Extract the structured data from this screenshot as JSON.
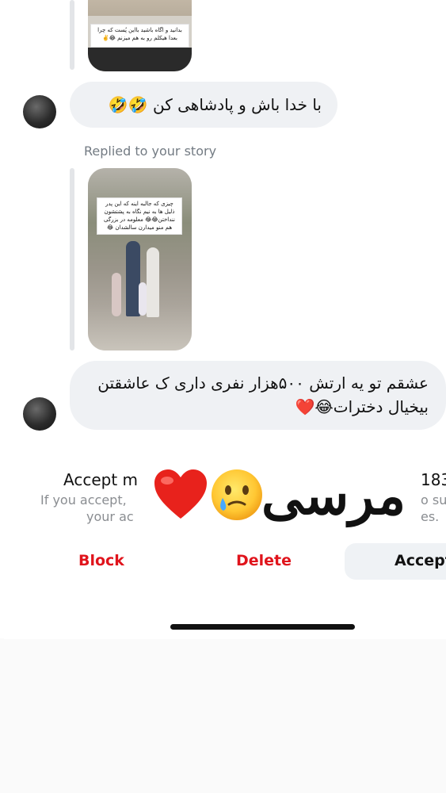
{
  "messages": {
    "story_1_caption": "بدانید و اگاه باشید بااین پُست که چرا بعدا هیکلم رو به هم میزنم 😂✌️",
    "bubble_1": "با خدا باش و پادشاهی کن 🤣🤣",
    "replied_label": "Replied to your story",
    "story_2_caption": "چیزی که جالبه اینه که این پدر ذلیل ها به نیم نگاه به پشتشون ننداختن😂😂 معلومه در بزرگی هم منو میدارن سالشدان 😂",
    "bubble_2": "عشقم تو یه ارتش ۵۰۰هزار نفری داری ک عاشقتن بیخیال دخترات😂❤️"
  },
  "request_sheet": {
    "title": "Accept m",
    "title_suffix": "183",
    "info_line1": "If you accept,",
    "info_line1_suffix": "o su",
    "info_line2": "your ac",
    "info_line2_suffix": "es.",
    "block_label": "Block",
    "delete_label": "Delete",
    "accept_label": "Accept"
  },
  "sticker": {
    "text": "مرسی",
    "icons": [
      "heart-icon",
      "face-holding-back-tears-icon"
    ]
  },
  "colors": {
    "danger": "#e0141c",
    "bubble_bg": "#eff1f4",
    "muted_text": "#737b83"
  }
}
